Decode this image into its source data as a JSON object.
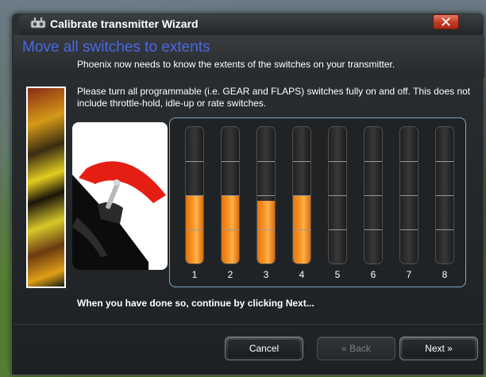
{
  "window": {
    "title": "Calibrate transmitter Wizard",
    "close_label": "✕"
  },
  "content": {
    "heading": "Move all switches to extents",
    "description_1": "Phoenix now needs to know the extents of the switches on your transmitter.",
    "description_2": "Please turn all programmable (i.e. GEAR and FLAPS) switches fully on and off. This does not include throttle-hold, idle-up or rate switches.",
    "footer_note": "When you have done so, continue by clicking Next..."
  },
  "channels": [
    {
      "label": "1",
      "level": 0.5
    },
    {
      "label": "2",
      "level": 0.5
    },
    {
      "label": "3",
      "level": 0.46
    },
    {
      "label": "4",
      "level": 0.5
    },
    {
      "label": "5",
      "level": 0
    },
    {
      "label": "6",
      "level": 0
    },
    {
      "label": "7",
      "level": 0
    },
    {
      "label": "8",
      "level": 0
    }
  ],
  "buttons": {
    "cancel": "Cancel",
    "back": "« Back",
    "next": "Next »"
  },
  "colors": {
    "heading": "#4b69e2",
    "meter_fill": "#ff9a2a",
    "panel_border": "#7fa9c0"
  },
  "icons": [
    "wizard-icon",
    "close-icon"
  ]
}
